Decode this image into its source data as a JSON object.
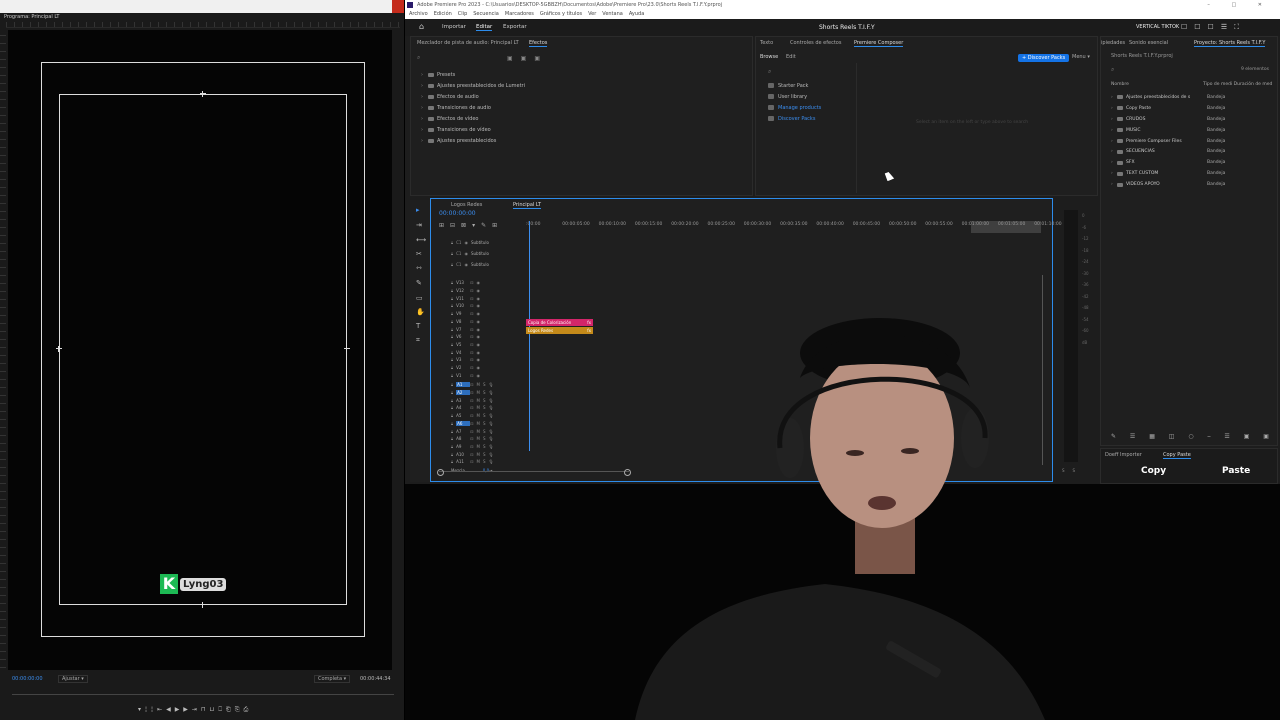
{
  "left_window": {
    "tab_label": "Programa: Principal LT",
    "timecode": "00:00:00:00",
    "fit": "Ajustar",
    "quality": "Completa",
    "duration": "00:00:44:34",
    "logo_text": "Lyng03",
    "buttons": [
      "▾",
      "¦",
      "¦",
      "⇤",
      "◀",
      "▶",
      "▶",
      "⇥",
      "⊓",
      "⊔",
      "⎕",
      "⎗",
      "⎘",
      "⎙"
    ]
  },
  "window": {
    "title": "Adobe Premiere Pro 2023 - C:\\Usuarios\\DESKTOP-5GBBZH\\Documentos\\Adobe\\Premiere Pro\\23.0\\Shorts Reels T.I.F.Y.prproj",
    "controls": "– □ ✕"
  },
  "menu": [
    "Archivo",
    "Edición",
    "Clip",
    "Secuencia",
    "Marcadores",
    "Gráficos y títulos",
    "Ver",
    "Ventana",
    "Ayuda"
  ],
  "header": {
    "workspaces": [
      "Importar",
      "Editar",
      "Exportar"
    ],
    "active_workspace": "Editar",
    "project_name": "Shorts Reels T.I.F.Y",
    "vertical_label": "VERTICAL TIKTOK",
    "icons": [
      "☐",
      "☐",
      "☐",
      "☰",
      "⛶"
    ]
  },
  "effects_panel": {
    "tabs": [
      "Mezclador de pista de audio: Principal LT",
      "Efectos"
    ],
    "active_tab": "Efectos",
    "items": [
      "Presets",
      "Ajustes preestablecidos de Lumetri",
      "Efectos de audio",
      "Transiciones de audio",
      "Efectos de vídeo",
      "Transiciones de vídeo",
      "Ajustes preestablecidos"
    ]
  },
  "composer_panel": {
    "tabs": [
      "Texto",
      "Controles de efectos",
      "Premiere Composer"
    ],
    "active_tab": "Premiere Composer",
    "subtabs": [
      "Browse",
      "Edit"
    ],
    "discover_button": "+ Discover Packs",
    "menu": "Menu",
    "items": [
      "Starter Pack",
      "User library",
      "Manage products",
      "Discover Packs"
    ],
    "empty_text": "Select an item on the left or type above to search"
  },
  "project_panel": {
    "tabs": [
      "ipiedades",
      "Sonido esencial",
      "Proyecto: Shorts Reels T.I.F.Y"
    ],
    "path": "Shorts Reels T.I.F.Y.prproj",
    "count": "9 elementos",
    "col_name": "Nombre",
    "col_type": "Tipo de medi Duración de med",
    "items": [
      {
        "name": "Ajustes preestablecidos de s",
        "type": "Bandeja"
      },
      {
        "name": "Copy Paste",
        "type": "Bandeja"
      },
      {
        "name": "CRUDOS",
        "type": "Bandeja"
      },
      {
        "name": "MUSIC",
        "type": "Bandeja"
      },
      {
        "name": "Premiere Composer Files",
        "type": "Bandeja"
      },
      {
        "name": "SECUENCIAS",
        "type": "Bandeja"
      },
      {
        "name": "SFX",
        "type": "Bandeja"
      },
      {
        "name": "TEXT CUSTOM",
        "type": "Bandeja"
      },
      {
        "name": "VIDEOS APOYO",
        "type": "Bandeja"
      }
    ]
  },
  "copypaste_panel": {
    "tabs": [
      "Doeff Importer",
      "Copy Paste"
    ],
    "copy": "Copy",
    "paste": "Paste"
  },
  "timeline": {
    "tabs": [
      "Logos Redes",
      "Principal LT"
    ],
    "active_tab": "Principal LT",
    "timecode": "00:00:00:00",
    "ruler": [
      ":00:00",
      "00:00:05:00",
      "00:00:10:00",
      "00:00:15:00",
      "00:00:20:00",
      "00:00:25:00",
      "00:00:30:00",
      "00:00:35:00",
      "00:00:40:00",
      "00:00:45:00",
      "00:00:50:00",
      "00:00:55:00",
      "00:01:00:00",
      "00:01:05:00",
      "00:01:10:00"
    ],
    "text_tracks": [
      "Subtítulo",
      "Subtítulo",
      "Subtítulo"
    ],
    "video_tracks": [
      "V13",
      "V12",
      "V11",
      "V10",
      "V9",
      "V8",
      "V7",
      "V6",
      "V5",
      "V4",
      "V3",
      "V2",
      "V1"
    ],
    "audio_tracks": [
      "A1",
      "A2",
      "A3",
      "A4",
      "A5",
      "A6",
      "A7",
      "A8",
      "A9",
      "A10",
      "A11"
    ],
    "mix_label": "Mezcla",
    "mix_value": "0,0",
    "clips": [
      "Copia de Colorización",
      "Logos Redes"
    ],
    "fx_badge": "fx",
    "meter_scale": [
      "0",
      "-6",
      "-12",
      "-18",
      "-24",
      "-30",
      "-36",
      "-42",
      "-48",
      "-54",
      "-60",
      "dB"
    ],
    "meter_footer": [
      "S",
      "S"
    ]
  },
  "colors": {
    "accent": "#2d8ceb",
    "clip_pink": "#d3266a",
    "clip_orange": "#c48a1a",
    "timecode_blue": "#3b8ef0",
    "logo_green": "#1db954"
  }
}
